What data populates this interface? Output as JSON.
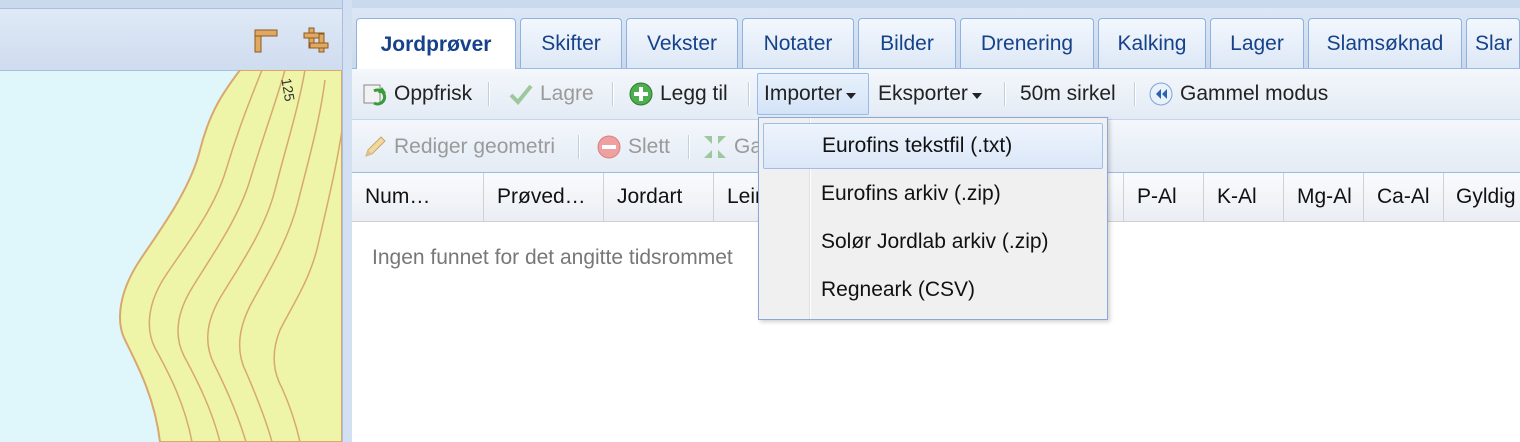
{
  "map": {
    "contour_label": "125",
    "tools": [
      "measure-tool-icon",
      "crop-tool-icon"
    ],
    "colors": {
      "water": "#dff7fb",
      "land": "#eef4a8",
      "contour": "#d8a86e"
    }
  },
  "tabs": [
    {
      "label": "Jordprøver",
      "active": true
    },
    {
      "label": "Skifter"
    },
    {
      "label": "Vekster"
    },
    {
      "label": "Notater"
    },
    {
      "label": "Bilder"
    },
    {
      "label": "Drenering"
    },
    {
      "label": "Kalking"
    },
    {
      "label": "Lager"
    },
    {
      "label": "Slamsøknad"
    },
    {
      "label": "Slar"
    }
  ],
  "toolbar": {
    "refresh": "Oppfrisk",
    "save": "Lagre",
    "add": "Legg til",
    "import": "Importer",
    "export": "Eksporter",
    "circle": "50m sirkel",
    "old_mode": "Gammel modus"
  },
  "toolbar2": {
    "edit_geometry": "Rediger geometri",
    "delete": "Slett",
    "partial": "Ga"
  },
  "grid": {
    "columns": [
      "Num…",
      "Prøved…",
      "Jordart",
      "Leir",
      "",
      "",
      "P-Al",
      "K-Al",
      "Mg-Al",
      "Ca-Al",
      "Gyldig"
    ],
    "empty_text": "Ingen funnet for det angitte tidsrommet"
  },
  "import_menu": {
    "items": [
      "Eurofins tekstfil (.txt)",
      "Eurofins arkiv (.zip)",
      "Solør Jordlab arkiv (.zip)",
      "Regneark (CSV)"
    ],
    "highlighted_index": 0
  }
}
